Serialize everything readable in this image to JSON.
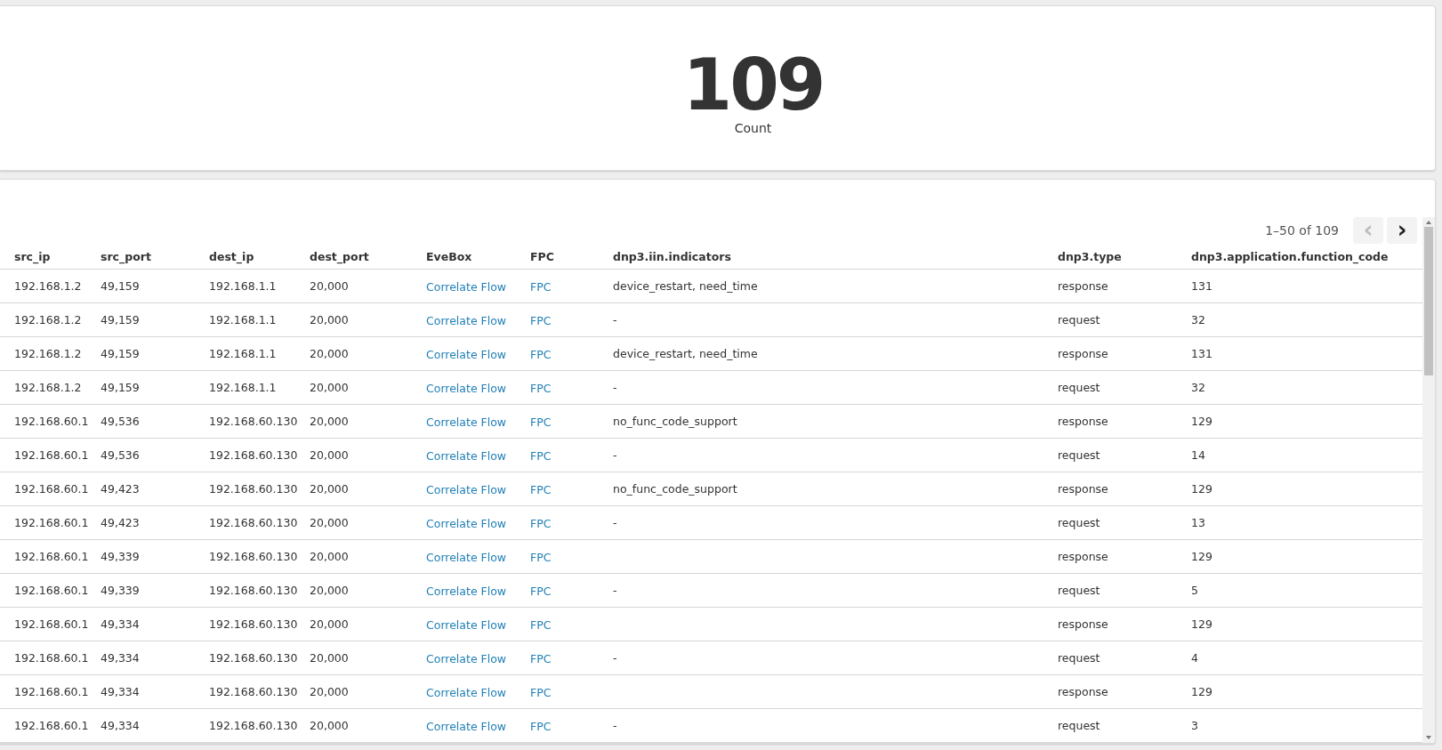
{
  "summary": {
    "value": "109",
    "label": "Count"
  },
  "pagination": {
    "range": "1–50 of 109",
    "prev": {
      "label": "‹",
      "disabled": true
    },
    "next": {
      "label": "›",
      "disabled": false
    }
  },
  "table": {
    "columns": [
      "src_ip",
      "src_port",
      "dest_ip",
      "dest_port",
      "EveBox",
      "FPC",
      "dnp3.iin.indicators",
      "dnp3.type",
      "dnp3.application.function_code"
    ],
    "rows": [
      {
        "src_ip": "192.168.1.2",
        "src_port": "49,159",
        "dest_ip": "192.168.1.1",
        "dest_port": "20,000",
        "evebox": "Correlate Flow",
        "fpc": "FPC",
        "indicators": "device_restart, need_time",
        "type": "response",
        "function_code": "131"
      },
      {
        "src_ip": "192.168.1.2",
        "src_port": "49,159",
        "dest_ip": "192.168.1.1",
        "dest_port": "20,000",
        "evebox": "Correlate Flow",
        "fpc": "FPC",
        "indicators": "-",
        "type": "request",
        "function_code": "32"
      },
      {
        "src_ip": "192.168.1.2",
        "src_port": "49,159",
        "dest_ip": "192.168.1.1",
        "dest_port": "20,000",
        "evebox": "Correlate Flow",
        "fpc": "FPC",
        "indicators": "device_restart, need_time",
        "type": "response",
        "function_code": "131"
      },
      {
        "src_ip": "192.168.1.2",
        "src_port": "49,159",
        "dest_ip": "192.168.1.1",
        "dest_port": "20,000",
        "evebox": "Correlate Flow",
        "fpc": "FPC",
        "indicators": "-",
        "type": "request",
        "function_code": "32"
      },
      {
        "src_ip": "192.168.60.1",
        "src_port": "49,536",
        "dest_ip": "192.168.60.130",
        "dest_port": "20,000",
        "evebox": "Correlate Flow",
        "fpc": "FPC",
        "indicators": "no_func_code_support",
        "type": "response",
        "function_code": "129"
      },
      {
        "src_ip": "192.168.60.1",
        "src_port": "49,536",
        "dest_ip": "192.168.60.130",
        "dest_port": "20,000",
        "evebox": "Correlate Flow",
        "fpc": "FPC",
        "indicators": "-",
        "type": "request",
        "function_code": "14"
      },
      {
        "src_ip": "192.168.60.1",
        "src_port": "49,423",
        "dest_ip": "192.168.60.130",
        "dest_port": "20,000",
        "evebox": "Correlate Flow",
        "fpc": "FPC",
        "indicators": "no_func_code_support",
        "type": "response",
        "function_code": "129"
      },
      {
        "src_ip": "192.168.60.1",
        "src_port": "49,423",
        "dest_ip": "192.168.60.130",
        "dest_port": "20,000",
        "evebox": "Correlate Flow",
        "fpc": "FPC",
        "indicators": "-",
        "type": "request",
        "function_code": "13"
      },
      {
        "src_ip": "192.168.60.1",
        "src_port": "49,339",
        "dest_ip": "192.168.60.130",
        "dest_port": "20,000",
        "evebox": "Correlate Flow",
        "fpc": "FPC",
        "type": "response",
        "function_code": "129"
      },
      {
        "src_ip": "192.168.60.1",
        "src_port": "49,339",
        "dest_ip": "192.168.60.130",
        "dest_port": "20,000",
        "evebox": "Correlate Flow",
        "fpc": "FPC",
        "indicators": "-",
        "type": "request",
        "function_code": "5"
      },
      {
        "src_ip": "192.168.60.1",
        "src_port": "49,334",
        "dest_ip": "192.168.60.130",
        "dest_port": "20,000",
        "evebox": "Correlate Flow",
        "fpc": "FPC",
        "type": "response",
        "function_code": "129"
      },
      {
        "src_ip": "192.168.60.1",
        "src_port": "49,334",
        "dest_ip": "192.168.60.130",
        "dest_port": "20,000",
        "evebox": "Correlate Flow",
        "fpc": "FPC",
        "indicators": "-",
        "type": "request",
        "function_code": "4"
      },
      {
        "src_ip": "192.168.60.1",
        "src_port": "49,334",
        "dest_ip": "192.168.60.130",
        "dest_port": "20,000",
        "evebox": "Correlate Flow",
        "fpc": "FPC",
        "type": "response",
        "function_code": "129"
      },
      {
        "src_ip": "192.168.60.1",
        "src_port": "49,334",
        "dest_ip": "192.168.60.130",
        "dest_port": "20,000",
        "evebox": "Correlate Flow",
        "fpc": "FPC",
        "indicators": "-",
        "type": "request",
        "function_code": "3"
      }
    ]
  }
}
